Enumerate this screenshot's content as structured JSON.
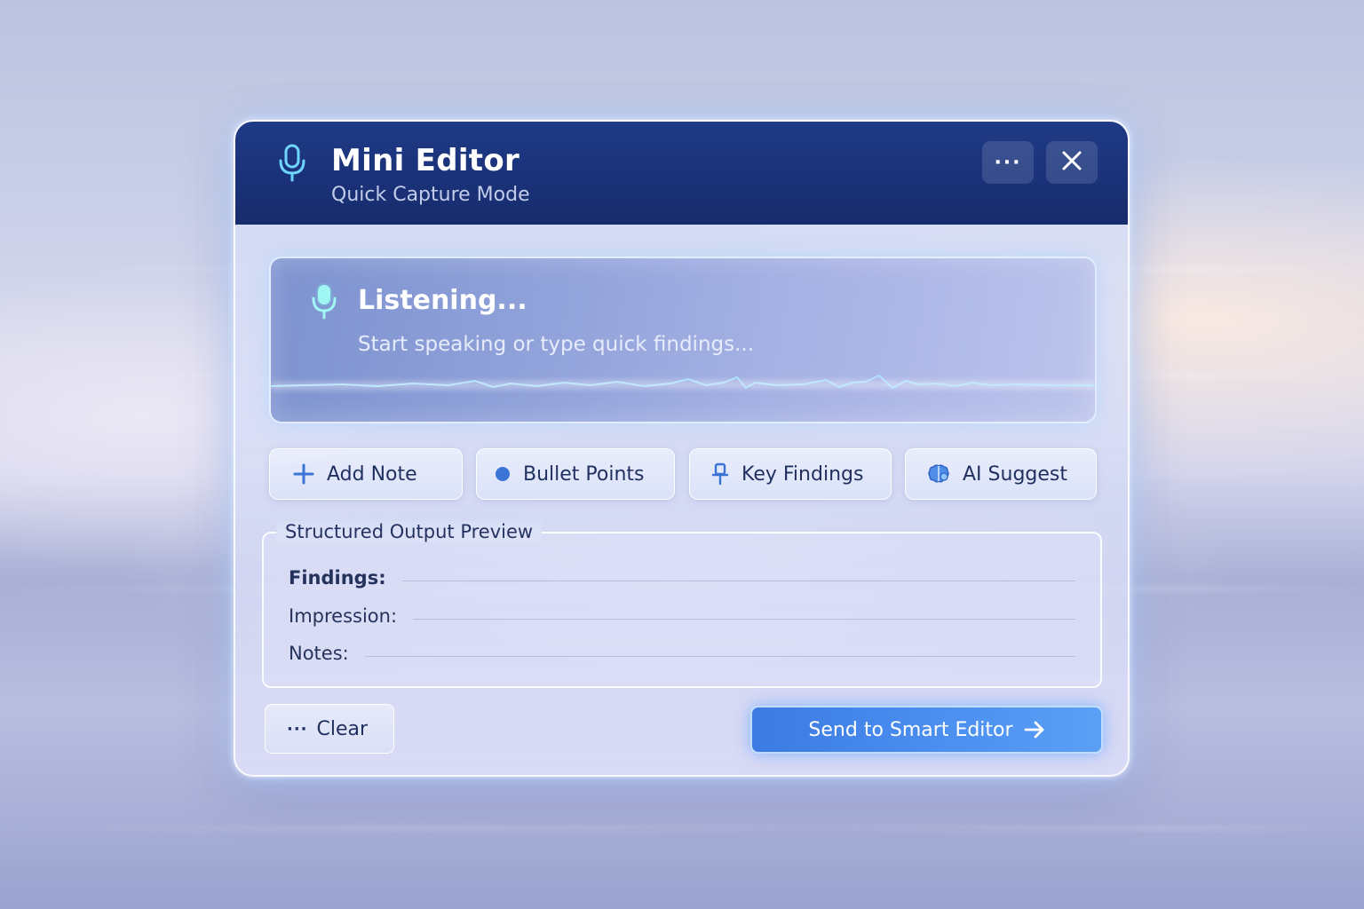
{
  "window": {
    "title": "Mini Editor",
    "subtitle": "Quick Capture Mode",
    "icon": "microphone-icon",
    "more_label": "···",
    "more_icon": "more-icon",
    "close_icon": "close-icon"
  },
  "listening": {
    "status": "Listening...",
    "hint": "Start speaking or type quick findings...",
    "icon": "microphone-icon"
  },
  "actions": [
    {
      "label": "Add Note",
      "icon": "plus-icon"
    },
    {
      "label": "Bullet Points",
      "icon": "bullet-icon"
    },
    {
      "label": "Key Findings",
      "icon": "pin-icon"
    },
    {
      "label": "AI Suggest",
      "icon": "brain-icon"
    }
  ],
  "preview": {
    "legend": "Structured Output Preview",
    "fields": [
      {
        "label": "Findings:"
      },
      {
        "label": "Impression:"
      },
      {
        "label": "Notes:"
      }
    ]
  },
  "footer": {
    "clear_dots": "···",
    "clear_label": "Clear",
    "send_label": "Send to Smart Editor",
    "send_icon": "arrow-right-icon"
  },
  "colors": {
    "titlebar": "#1a3279",
    "accent": "#4b8ff0",
    "text_dark": "#1f2f5f",
    "mic_glow": "#7ff0f0"
  }
}
